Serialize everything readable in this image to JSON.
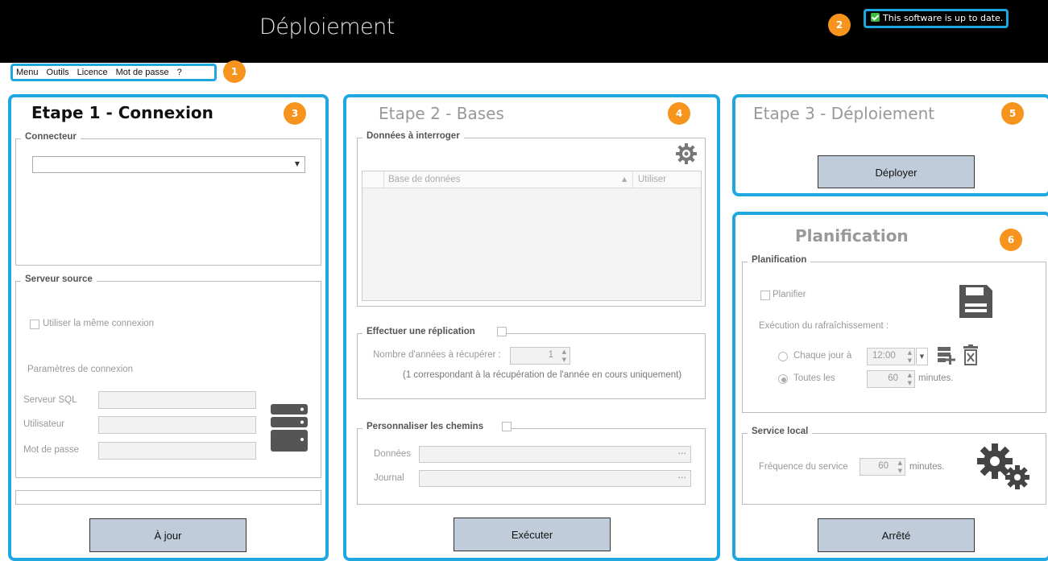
{
  "header": {
    "title": "Déploiement",
    "update_status": "This software is up to date."
  },
  "badges": [
    "1",
    "2",
    "3",
    "4",
    "5",
    "6"
  ],
  "menu": {
    "items": [
      "Menu",
      "Outils",
      "Licence",
      "Mot de passe",
      "?"
    ]
  },
  "step1": {
    "title": "Etape 1 - Connexion",
    "connecteur_label": "Connecteur",
    "connecteur_value": "",
    "serveur_source_label": "Serveur source",
    "same_connection_label": "Utiliser la même connexion",
    "params_label": "Paramètres de connexion",
    "serveur_sql_label": "Serveur SQL",
    "utilisateur_label": "Utilisateur",
    "mot_de_passe_label": "Mot de passe",
    "button": "À jour"
  },
  "step2": {
    "title": "Etape 2 - Bases",
    "donnees_group": "Données à interroger",
    "col_base": "Base de données",
    "col_utiliser": "Utiliser",
    "replication_label": "Effectuer une réplication",
    "nb_annees_label": "Nombre d'années à récupérer :",
    "nb_annees_value": "1",
    "replication_note": "(1 correspondant à la récupération de l'année en cours uniquement)",
    "chemins_label": "Personnaliser les chemins",
    "donnees_label": "Données",
    "journal_label": "Journal",
    "ellipsis": "···",
    "button": "Exécuter"
  },
  "step3": {
    "title": "Etape 3 - Déploiement",
    "button": "Déployer"
  },
  "planif": {
    "title": "Planification",
    "group_label": "Planification",
    "planifier_label": "Planifier",
    "exec_label": "Exécution du rafraîchissement :",
    "chaque_jour_label": "Chaque jour à",
    "time_value": "12:00",
    "toutes_les_label": "Toutes les",
    "minutes_value": "60",
    "minutes_label": "minutes.",
    "service_group_label": "Service local",
    "frequence_label": "Fréquence du service",
    "frequence_value": "60",
    "frequence_minutes_label": "minutes.",
    "button": "Arrêté"
  },
  "colors": {
    "accent": "#1ea7e1",
    "badge": "#f7941d",
    "button": "#c0ccd9"
  }
}
